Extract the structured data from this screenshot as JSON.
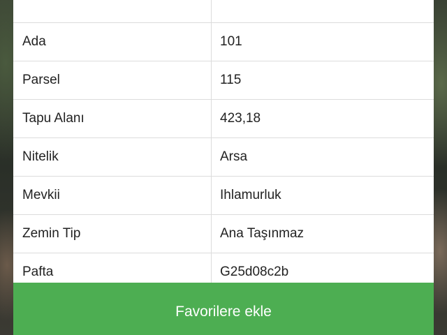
{
  "table": {
    "rows": [
      {
        "label": "",
        "value": ""
      },
      {
        "label": "Ada",
        "value": "101"
      },
      {
        "label": "Parsel",
        "value": "115"
      },
      {
        "label": "Tapu Alanı",
        "value": "423,18"
      },
      {
        "label": "Nitelik",
        "value": "Arsa"
      },
      {
        "label": "Mevkii",
        "value": "Ihlamurluk"
      },
      {
        "label": "Zemin Tip",
        "value": "Ana Taşınmaz"
      },
      {
        "label": "Pafta",
        "value": "G25d08c2b"
      }
    ]
  },
  "actions": {
    "favorite_label": "Favorilere ekle"
  },
  "colors": {
    "button_green": "#4dae52",
    "divider": "#dcdcdc",
    "text": "#222222"
  }
}
